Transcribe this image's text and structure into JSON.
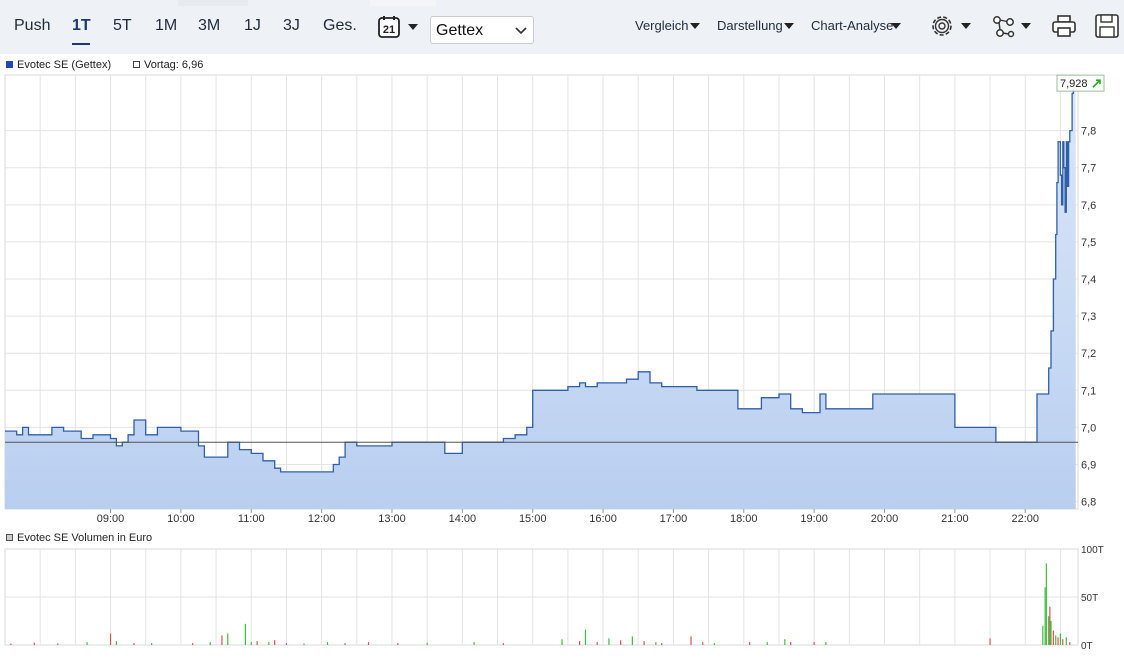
{
  "toolbar": {
    "periods": [
      "Push",
      "1T",
      "5T",
      "1M",
      "3M",
      "1J",
      "3J",
      "Ges."
    ],
    "active_period": "1T",
    "calendar_day": "21",
    "exchange_select": "Gettex",
    "menus": [
      "Vergleich",
      "Darstellung",
      "Chart-Analyse"
    ],
    "icons": [
      "settings-icon",
      "network-icon",
      "print-icon",
      "save-icon"
    ]
  },
  "legend": {
    "series_label": "Evotec SE (Gettex)",
    "prev_close_label": "Vortag: 6,96",
    "volume_label": "Evotec SE Volumen in Euro"
  },
  "colors": {
    "line": "#2e5faa",
    "fill_top": "#dbe7f9",
    "fill_bottom": "#b9cff0",
    "up_volume": "#3cbf3c",
    "down_volume": "#d9534f",
    "grid": "#e3e3e3"
  },
  "chart_data": [
    {
      "type": "area",
      "title": "Evotec SE (Gettex)",
      "x_ticks": [
        "09:00",
        "10:00",
        "11:00",
        "12:00",
        "13:00",
        "14:00",
        "15:00",
        "16:00",
        "17:00",
        "18:00",
        "19:00",
        "20:00",
        "21:00",
        "22:00"
      ],
      "y_ticks": [
        "6,8",
        "6,9",
        "7,0",
        "7,1",
        "7,2",
        "7,3",
        "7,4",
        "7,5",
        "7,6",
        "7,7",
        "7,8"
      ],
      "ylim": [
        6.78,
        7.95
      ],
      "xlim": [
        "07:30",
        "22:45"
      ],
      "reference_line": 6.96,
      "last_value_label": "7,928",
      "x": [
        "07:30",
        "07:40",
        "07:45",
        "07:50",
        "08:10",
        "08:20",
        "08:35",
        "08:45",
        "09:00",
        "09:05",
        "09:10",
        "09:15",
        "09:20",
        "09:30",
        "09:40",
        "10:00",
        "10:15",
        "10:20",
        "10:40",
        "10:50",
        "11:00",
        "11:10",
        "11:20",
        "11:25",
        "11:35",
        "11:50",
        "12:00",
        "12:10",
        "12:15",
        "12:20",
        "12:30",
        "12:45",
        "13:00",
        "13:20",
        "13:40",
        "13:45",
        "14:00",
        "14:30",
        "14:35",
        "14:45",
        "14:55",
        "15:00",
        "15:05",
        "15:30",
        "15:40",
        "15:45",
        "15:55",
        "16:05",
        "16:20",
        "16:30",
        "16:40",
        "16:50",
        "17:00",
        "17:20",
        "17:40",
        "17:55",
        "18:10",
        "18:15",
        "18:30",
        "18:40",
        "18:50",
        "19:00",
        "19:05",
        "19:10",
        "19:25",
        "19:50",
        "20:40",
        "21:00",
        "21:35",
        "21:40",
        "21:55",
        "22:10",
        "22:15",
        "22:20",
        "22:22",
        "22:24",
        "22:26",
        "22:27",
        "22:28",
        "22:30",
        "22:31",
        "22:32",
        "22:33",
        "22:34",
        "22:35",
        "22:36",
        "22:37",
        "22:38",
        "22:40",
        "22:41",
        "22:43"
      ],
      "series": [
        {
          "name": "Evotec SE (Gettex)",
          "values": [
            6.99,
            6.98,
            7.0,
            6.98,
            7.0,
            6.99,
            6.97,
            6.98,
            6.97,
            6.95,
            6.96,
            6.98,
            7.02,
            6.98,
            7.0,
            6.99,
            6.95,
            6.92,
            6.96,
            6.94,
            6.93,
            6.91,
            6.89,
            6.88,
            6.88,
            6.88,
            6.88,
            6.9,
            6.92,
            6.96,
            6.95,
            6.95,
            6.96,
            6.96,
            6.96,
            6.93,
            6.96,
            6.96,
            6.97,
            6.98,
            7.0,
            7.1,
            7.1,
            7.11,
            7.12,
            7.11,
            7.12,
            7.12,
            7.13,
            7.15,
            7.12,
            7.11,
            7.11,
            7.1,
            7.1,
            7.05,
            7.05,
            7.08,
            7.09,
            7.05,
            7.04,
            7.04,
            7.09,
            7.05,
            7.05,
            7.09,
            7.09,
            7.0,
            6.96,
            6.96,
            6.96,
            7.09,
            7.09,
            7.16,
            7.26,
            7.4,
            7.52,
            7.66,
            7.77,
            7.68,
            7.6,
            7.77,
            7.7,
            7.58,
            7.77,
            7.65,
            7.77,
            7.8,
            7.9,
            7.93,
            7.928
          ]
        }
      ]
    },
    {
      "type": "bar",
      "title": "Evotec SE Volumen in Euro",
      "y_ticks": [
        "0T",
        "50T",
        "100T"
      ],
      "ylim": [
        0,
        100000
      ],
      "x": [
        "07:35",
        "07:55",
        "08:15",
        "08:40",
        "09:00",
        "09:05",
        "09:20",
        "09:35",
        "10:10",
        "10:25",
        "10:35",
        "10:40",
        "10:55",
        "11:00",
        "11:05",
        "11:15",
        "11:20",
        "11:30",
        "11:45",
        "12:05",
        "12:20",
        "12:40",
        "13:05",
        "13:30",
        "14:10",
        "14:35",
        "15:25",
        "15:40",
        "15:45",
        "15:55",
        "16:05",
        "16:15",
        "16:25",
        "16:35",
        "16:45",
        "16:50",
        "17:15",
        "17:25",
        "17:35",
        "18:05",
        "18:20",
        "18:35",
        "18:40",
        "19:00",
        "19:10",
        "21:30",
        "22:15",
        "22:17",
        "22:18",
        "22:20",
        "22:21",
        "22:22",
        "22:24",
        "22:26",
        "22:28",
        "22:30",
        "22:32",
        "22:35",
        "22:38"
      ],
      "values": [
        1500,
        2500,
        1500,
        3000,
        12000,
        4000,
        2000,
        2000,
        2000,
        3000,
        10000,
        12000,
        22000,
        3000,
        4000,
        3000,
        5000,
        2000,
        1500,
        3000,
        2000,
        3000,
        2000,
        2500,
        3000,
        2000,
        6000,
        4000,
        16000,
        3000,
        7000,
        5000,
        9000,
        4000,
        3000,
        2000,
        9000,
        3000,
        2000,
        3000,
        3000,
        6000,
        3000,
        3000,
        3000,
        7000,
        20000,
        60000,
        85000,
        30000,
        40000,
        25000,
        15000,
        10000,
        8000,
        12000,
        6000,
        8000,
        3000
      ],
      "direction": [
        "down",
        "down",
        "down",
        "up",
        "down",
        "up",
        "down",
        "up",
        "down",
        "up",
        "down",
        "up",
        "up",
        "up",
        "down",
        "up",
        "down",
        "down",
        "up",
        "up",
        "down",
        "down",
        "down",
        "up",
        "up",
        "down",
        "up",
        "down",
        "up",
        "down",
        "up",
        "down",
        "up",
        "down",
        "up",
        "down",
        "down",
        "down",
        "up",
        "down",
        "up",
        "up",
        "down",
        "down",
        "up",
        "down",
        "up",
        "up",
        "up",
        "up",
        "down",
        "up",
        "down",
        "up",
        "down",
        "up",
        "down",
        "up",
        "down"
      ]
    }
  ]
}
